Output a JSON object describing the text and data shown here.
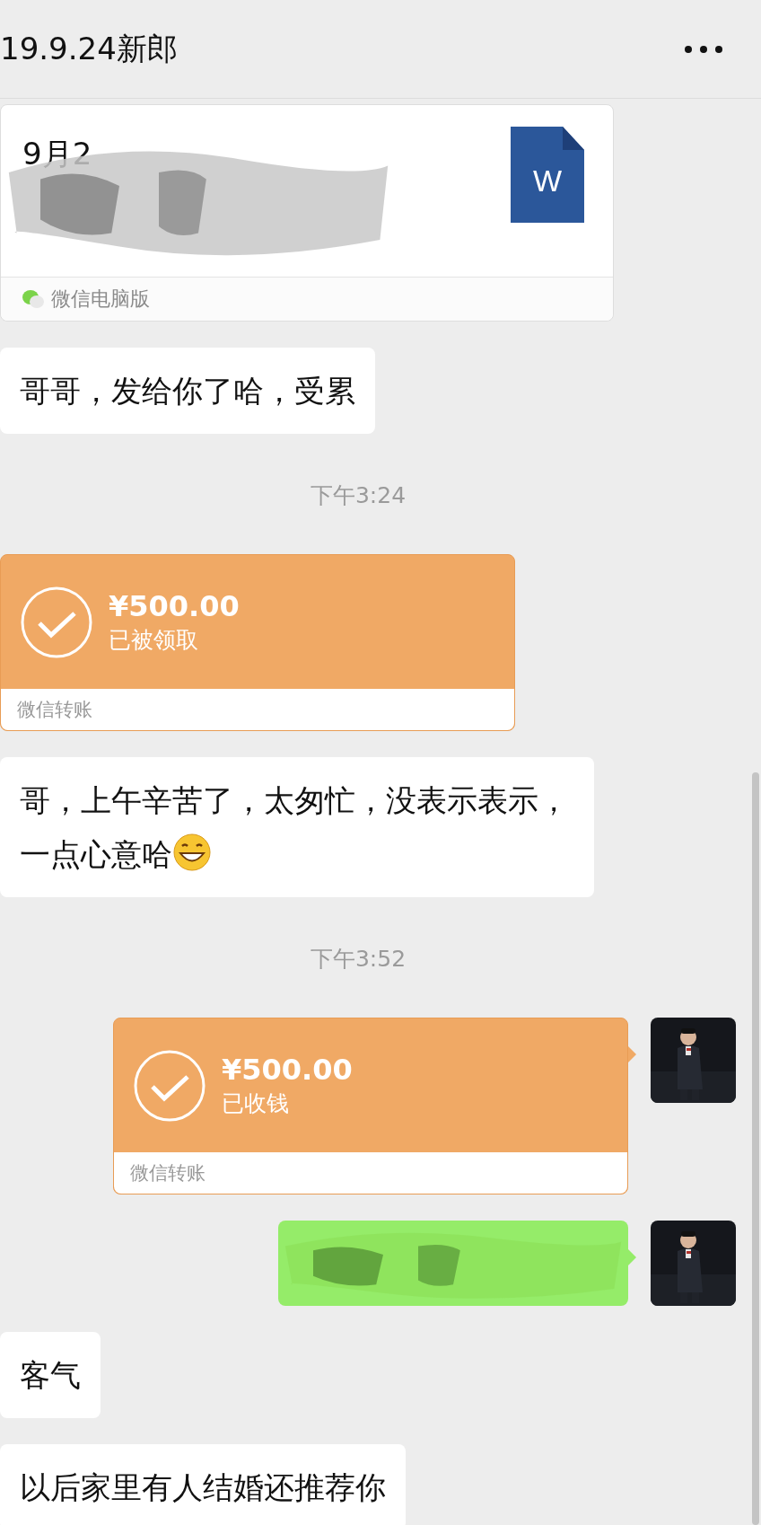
{
  "header": {
    "title": "19.9.24新郎"
  },
  "messages": [
    {
      "kind": "file",
      "outgoing": false,
      "file_name": "9月2",
      "icon_letter": "W",
      "source": "微信电脑版"
    },
    {
      "kind": "text",
      "outgoing": false,
      "text": "哥哥，发给你了哈，受累"
    },
    {
      "kind": "time",
      "text": "下午3:24"
    },
    {
      "kind": "transfer",
      "outgoing": false,
      "amount": "¥500.00",
      "status": "已被领取",
      "source": "微信转账"
    },
    {
      "kind": "text",
      "outgoing": false,
      "text": "哥，上午辛苦了，太匆忙，没表示表示，一点心意哈",
      "emoji": true
    },
    {
      "kind": "time",
      "text": "下午3:52"
    },
    {
      "kind": "transfer",
      "outgoing": true,
      "amount": "¥500.00",
      "status": "已收钱",
      "source": "微信转账"
    },
    {
      "kind": "redacted",
      "outgoing": true
    },
    {
      "kind": "text",
      "outgoing": false,
      "text": "客气"
    },
    {
      "kind": "text",
      "outgoing": false,
      "text": "以后家里有人结婚还推荐你"
    }
  ]
}
